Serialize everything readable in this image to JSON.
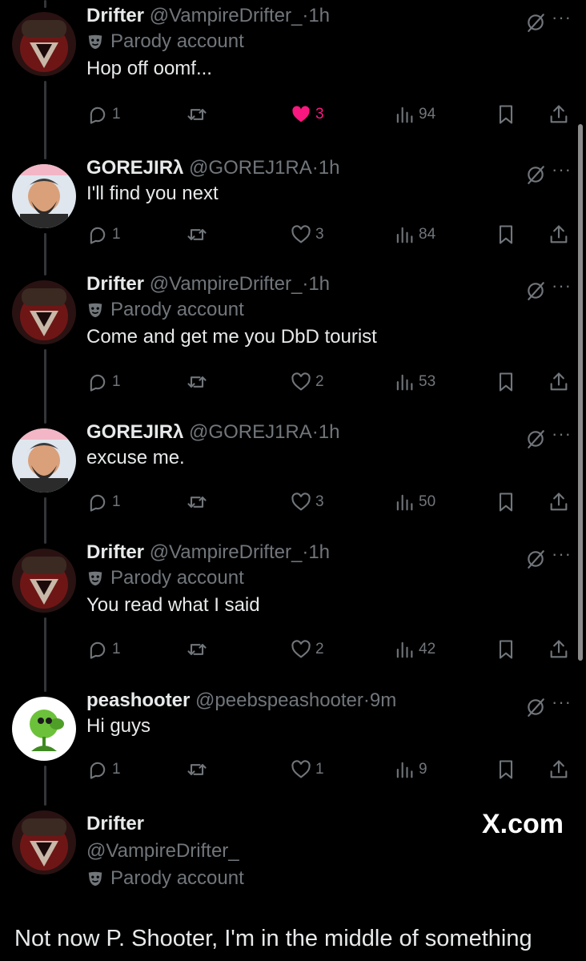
{
  "tweets": [
    {
      "name": "Drifter",
      "handle": "@VampireDrifter_",
      "time": "1h",
      "parody": "Parody account",
      "text": "Hop off oomf...",
      "replies": "1",
      "likes": "3",
      "views": "94",
      "liked": true,
      "avatar": "drifter"
    },
    {
      "name": "GOREJIRλ",
      "handle": "@GOREJ1RA",
      "time": "1h",
      "parody": "",
      "text": "I'll find you next",
      "replies": "1",
      "likes": "3",
      "views": "84",
      "liked": false,
      "avatar": "gorejira"
    },
    {
      "name": "Drifter",
      "handle": "@VampireDrifter_",
      "time": "1h",
      "parody": "Parody account",
      "text": "Come and get me you DbD tourist",
      "replies": "1",
      "likes": "2",
      "views": "53",
      "liked": false,
      "avatar": "drifter"
    },
    {
      "name": "GOREJIRλ",
      "handle": "@GOREJ1RA",
      "time": "1h",
      "parody": "",
      "text": "excuse me.",
      "replies": "1",
      "likes": "3",
      "views": "50",
      "liked": false,
      "avatar": "gorejira"
    },
    {
      "name": "Drifter",
      "handle": "@VampireDrifter_",
      "time": "1h",
      "parody": "Parody account",
      "text": "You read what I said",
      "replies": "1",
      "likes": "2",
      "views": "42",
      "liked": false,
      "avatar": "drifter"
    },
    {
      "name": "peashooter",
      "handle": "@peebspeashooter",
      "time": "9m",
      "parody": "",
      "text": "Hi guys",
      "replies": "1",
      "likes": "1",
      "views": "9",
      "liked": false,
      "avatar": "peashooter"
    }
  ],
  "main_tweet": {
    "name": "Drifter",
    "handle": "@VampireDrifter_",
    "parody": "Parody account",
    "text": "Not now P. Shooter, I'm in the middle of something"
  },
  "watermark": "X.com",
  "separator": "·",
  "icons": {
    "reply": "reply-icon",
    "retweet": "retweet-icon",
    "like": "heart-icon",
    "views": "views-icon",
    "bookmark": "bookmark-icon",
    "share": "share-icon",
    "grok": "grok-icon",
    "more": "more-icon",
    "parody": "parody-mask-icon"
  },
  "colors": {
    "background": "#000000",
    "text": "#e7e9ea",
    "muted": "#71767b",
    "like": "#f91880"
  }
}
